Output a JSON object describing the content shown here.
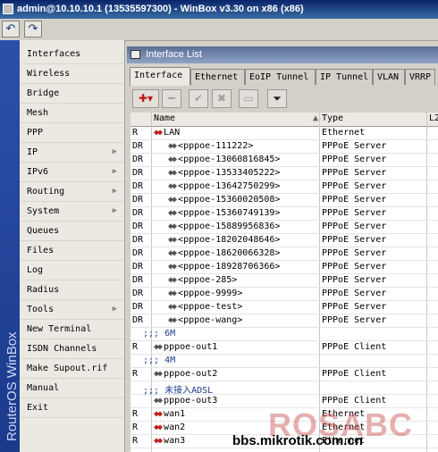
{
  "window_title": "admin@10.10.10.1 (13535597300) - WinBox v3.30 on x86 (x86)",
  "toolbar": {
    "undo_icon": "undo-icon",
    "redo_icon": "redo-icon"
  },
  "brand": "RouterOS WinBox",
  "sidebar": {
    "items": [
      {
        "label": "Interfaces",
        "submenu": false
      },
      {
        "label": "Wireless",
        "submenu": false
      },
      {
        "label": "Bridge",
        "submenu": false
      },
      {
        "label": "Mesh",
        "submenu": false
      },
      {
        "label": "PPP",
        "submenu": false
      },
      {
        "label": "IP",
        "submenu": true
      },
      {
        "label": "IPv6",
        "submenu": true
      },
      {
        "label": "Routing",
        "submenu": true
      },
      {
        "label": "System",
        "submenu": true
      },
      {
        "label": "Queues",
        "submenu": false
      },
      {
        "label": "Files",
        "submenu": false
      },
      {
        "label": "Log",
        "submenu": false
      },
      {
        "label": "Radius",
        "submenu": false
      },
      {
        "label": "Tools",
        "submenu": true
      },
      {
        "label": "New Terminal",
        "submenu": false
      },
      {
        "label": "ISDN Channels",
        "submenu": false
      },
      {
        "label": "Make Supout.rif",
        "submenu": false
      },
      {
        "label": "Manual",
        "submenu": false
      },
      {
        "label": "Exit",
        "submenu": false
      }
    ]
  },
  "interface_list": {
    "title": "Interface List",
    "tabs": [
      "Interface",
      "Ethernet",
      "EoIP Tunnel",
      "IP Tunnel",
      "VLAN",
      "VRRP"
    ],
    "active_tab": "Interface",
    "columns": [
      "Name",
      "Type",
      "L2"
    ],
    "rows": [
      {
        "flag": "R",
        "name": "LAN",
        "type": "Ethernet",
        "indent": false
      },
      {
        "flag": "DR",
        "name": "<pppoe-111222>",
        "type": "PPPoE Server",
        "indent": true
      },
      {
        "flag": "DR",
        "name": "<pppoe-13060816845>",
        "type": "PPPoE Server",
        "indent": true
      },
      {
        "flag": "DR",
        "name": "<pppoe-13533405222>",
        "type": "PPPoE Server",
        "indent": true
      },
      {
        "flag": "DR",
        "name": "<pppoe-13642750299>",
        "type": "PPPoE Server",
        "indent": true
      },
      {
        "flag": "DR",
        "name": "<pppoe-15360020508>",
        "type": "PPPoE Server",
        "indent": true
      },
      {
        "flag": "DR",
        "name": "<pppoe-15360749139>",
        "type": "PPPoE Server",
        "indent": true
      },
      {
        "flag": "DR",
        "name": "<pppoe-15889956836>",
        "type": "PPPoE Server",
        "indent": true
      },
      {
        "flag": "DR",
        "name": "<pppoe-18202048646>",
        "type": "PPPoE Server",
        "indent": true
      },
      {
        "flag": "DR",
        "name": "<pppoe-18620066328>",
        "type": "PPPoE Server",
        "indent": true
      },
      {
        "flag": "DR",
        "name": "<pppoe-18928706366>",
        "type": "PPPoE Server",
        "indent": true
      },
      {
        "flag": "DR",
        "name": "<pppoe-285>",
        "type": "PPPoE Server",
        "indent": true
      },
      {
        "flag": "DR",
        "name": "<pppoe-9999>",
        "type": "PPPoE Server",
        "indent": true
      },
      {
        "flag": "DR",
        "name": "<pppoe-test>",
        "type": "PPPoE Server",
        "indent": true
      },
      {
        "flag": "DR",
        "name": "<pppoe-wang>",
        "type": "PPPoE Server",
        "indent": true
      },
      {
        "comment": ";;; 6M"
      },
      {
        "flag": "R",
        "name": "pppoe-out1",
        "type": "PPPoE Client",
        "indent": false
      },
      {
        "comment": ";;; 4M"
      },
      {
        "flag": "R",
        "name": "pppoe-out2",
        "type": "PPPoE Client",
        "indent": false
      },
      {
        "comment": ";;; 未接入ADSL"
      },
      {
        "flag": "",
        "name": "pppoe-out3",
        "type": "PPPoE Client",
        "indent": false
      },
      {
        "flag": "R",
        "name": "wan1",
        "type": "Ethernet",
        "indent": false
      },
      {
        "flag": "R",
        "name": "wan2",
        "type": "Ethernet",
        "indent": false
      },
      {
        "flag": "R",
        "name": "wan3",
        "type": "Ethernet",
        "indent": false
      }
    ]
  },
  "watermark": {
    "logo": "ROSABC",
    "site": "bbs.mikrotik.com.cn"
  }
}
